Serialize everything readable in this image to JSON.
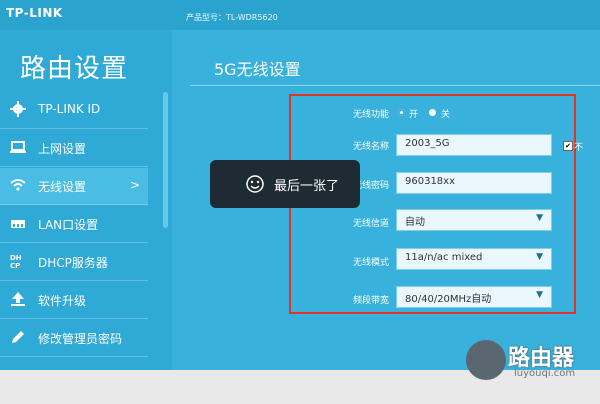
{
  "header": {
    "logo": "TP-LINK",
    "model": "产品型号：TL-WDR5620"
  },
  "sidebar": {
    "title": "路由设置",
    "items": [
      {
        "label": "TP-LINK ID",
        "icon": "gear-icon"
      },
      {
        "label": "上网设置",
        "icon": "laptop-icon"
      },
      {
        "label": "无线设置",
        "icon": "wifi-icon",
        "chevron": ">"
      },
      {
        "label": "LAN口设置",
        "icon": "lan-icon"
      },
      {
        "label": "DHCP服务器",
        "icon": "dhcp-icon"
      },
      {
        "label": "软件升级",
        "icon": "upload-icon"
      },
      {
        "label": "修改管理员密码",
        "icon": "pencil-icon"
      }
    ]
  },
  "main": {
    "title": "5G无线设置",
    "form": {
      "wifi_function_label": "无线功能",
      "on_label": "开",
      "off_label": "关",
      "ssid_label": "无线名称",
      "ssid_value": "2003_5G",
      "hide_label": "不",
      "password_label": "无线密码",
      "password_value": "960318xx",
      "channel_label": "无线信道",
      "channel_value": "自动",
      "mode_label": "无线模式",
      "mode_value": "11a/n/ac mixed",
      "bandwidth_label": "频段带宽",
      "bandwidth_value": "80/40/20MHz自动"
    }
  },
  "toast": {
    "message": "最后一张了"
  },
  "watermark": {
    "brand": "路由器",
    "url": "luyouqi.com"
  },
  "colors": {
    "accent": "#38b2dc",
    "sidebar": "#2fa9d6",
    "highlight": "#e0342a"
  }
}
